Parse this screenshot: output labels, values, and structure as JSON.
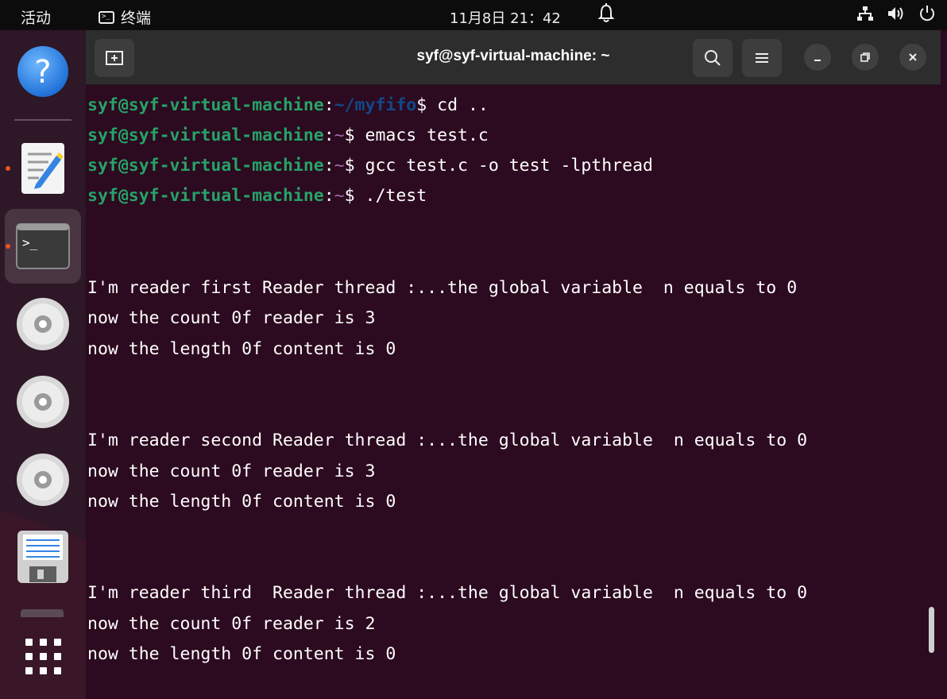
{
  "topbar": {
    "activities": "活动",
    "app_name": "终端",
    "clock": "11月8日  21：42"
  },
  "window": {
    "title": "syf@syf-virtual-machine: ~"
  },
  "terminal": {
    "lines": [
      {
        "user": "syf@syf-virtual-machine",
        "colon": ":",
        "path": "~/myfifo",
        "dollar": "$",
        "cmd": " cd .."
      },
      {
        "user": "syf@syf-virtual-machine",
        "colon": ":",
        "path": "~",
        "dollar": "$",
        "cmd": " emacs test.c"
      },
      {
        "user": "syf@syf-virtual-machine",
        "colon": ":",
        "path": "~",
        "dollar": "$",
        "cmd": " gcc test.c -o test -lpthread"
      },
      {
        "user": "syf@syf-virtual-machine",
        "colon": ":",
        "path": "~",
        "dollar": "$",
        "cmd": " ./test"
      }
    ],
    "output": [
      "I'm reader first Reader thread :...the global variable  n equals to 0",
      "now the count 0f reader is 3",
      "now the length 0f content is 0",
      "I'm reader second Reader thread :...the global variable  n equals to 0",
      "now the count 0f reader is 3",
      "now the length 0f content is 0",
      "I'm reader third  Reader thread :...the global variable  n equals to 0",
      "now the count 0f reader is 2",
      "now the length 0f content is 0"
    ]
  },
  "dock": {
    "items": [
      "help-icon",
      "text-editor-icon",
      "terminal-icon",
      "disc-icon",
      "disc-icon",
      "disc-icon",
      "save-icon",
      "apps-grid-icon"
    ]
  },
  "colors": {
    "terminal_bg": "#2c0a1f",
    "prompt_user": "#26a269",
    "prompt_path": "#12488b",
    "running_indicator": "#e95420"
  }
}
